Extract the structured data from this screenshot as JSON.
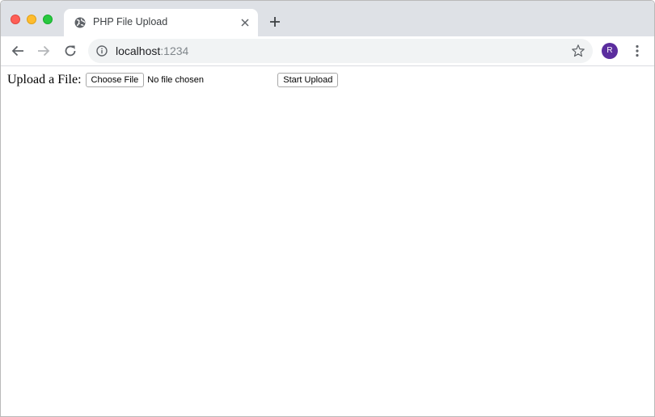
{
  "browser": {
    "tab_title": "PHP File Upload",
    "url_host": "localhost",
    "url_port": ":1234",
    "profile_initial": "R",
    "icons": {
      "favicon": "globe-icon",
      "tab_close": "close-icon",
      "new_tab": "plus-icon",
      "back": "arrow-left-icon",
      "forward": "arrow-right-icon",
      "reload": "reload-icon",
      "site_info": "info-icon",
      "bookmark": "star-icon",
      "menu": "kebab-menu-icon"
    },
    "colors": {
      "tabstrip": "#dee1e6",
      "omnibox": "#f1f3f4",
      "avatar": "#5b2d9e"
    }
  },
  "page": {
    "label": "Upload a File:",
    "file_button": "Choose File",
    "file_status": "No file chosen",
    "submit_button": "Start Upload"
  }
}
